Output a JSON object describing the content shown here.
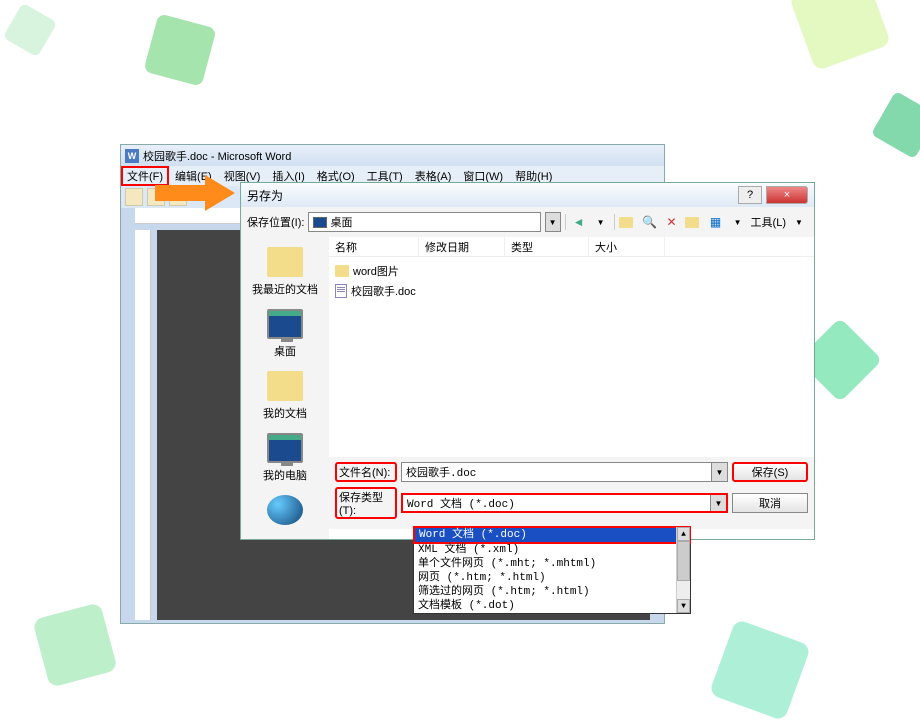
{
  "word": {
    "title": "校园歌手.doc - Microsoft Word",
    "menu": {
      "file": "文件(F)",
      "edit": "编辑(E)",
      "view": "视图(V)",
      "insert": "插入(I)",
      "format": "格式(O)",
      "tools": "工具(T)",
      "table": "表格(A)",
      "window": "窗口(W)",
      "help": "帮助(H)"
    }
  },
  "dialog": {
    "title": "另存为",
    "help": "?",
    "close": "×",
    "location_label": "保存位置(I):",
    "location_value": "桌面",
    "tools_label": "工具(L)",
    "columns": {
      "name": "名称",
      "modified": "修改日期",
      "type": "类型",
      "size": "大小"
    },
    "sidebar": {
      "recent": "我最近的文档",
      "desktop": "桌面",
      "mydocs": "我的文档",
      "mycomputer": "我的电脑"
    },
    "files": {
      "folder1": "word图片",
      "file1": "校园歌手.doc"
    },
    "filename_label": "文件名(N):",
    "filename_value": "校园歌手.doc",
    "filetype_label": "保存类型(T):",
    "filetype_value": "Word 文档 (*.doc)",
    "save_btn": "保存(S)",
    "cancel_btn": "取消"
  },
  "dropdown": {
    "items": [
      "Word 文档 (*.doc)",
      "XML 文档 (*.xml)",
      "单个文件网页 (*.mht; *.mhtml)",
      "网页 (*.htm; *.html)",
      "筛选过的网页 (*.htm; *.html)",
      "文档模板 (*.dot)"
    ],
    "selected_index": 0
  }
}
